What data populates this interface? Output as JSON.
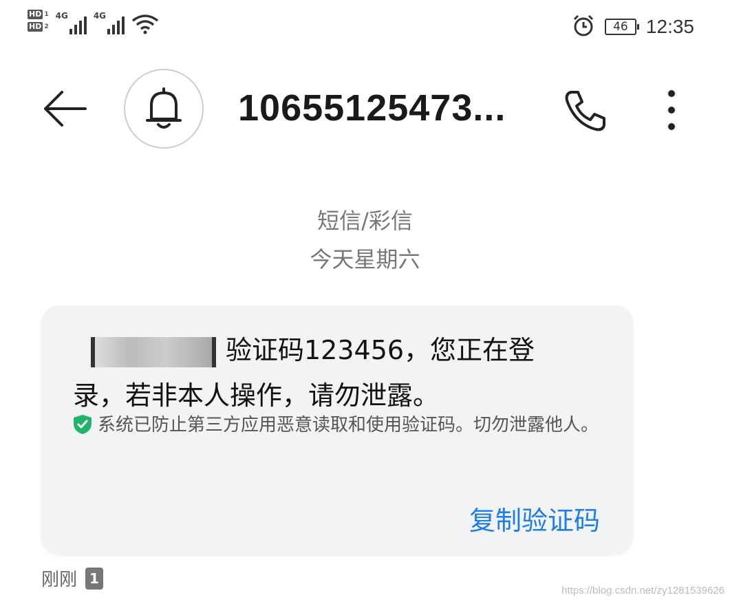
{
  "status_bar": {
    "sim1_label": "HD",
    "sim1_index": "1",
    "sim2_label": "HD",
    "sim2_index": "2",
    "network1": "4G",
    "network2": "4G",
    "battery": "46",
    "time": "12:35",
    "icons": [
      "hd-icon",
      "signal-icon",
      "wifi-icon",
      "alarm-icon",
      "battery-icon"
    ]
  },
  "header": {
    "sender": "10655125473...",
    "icons": [
      "back-arrow-icon",
      "bell-icon",
      "phone-icon",
      "more-vertical-icon"
    ]
  },
  "conversation": {
    "message_type": "短信/彩信",
    "date": "今天星期六"
  },
  "message": {
    "text": "验证码123456，您正在登录，若非本人操作，请勿泄露。",
    "notice": "系统已防止第三方应用恶意读取和使用验证码。切勿泄露他人。",
    "copy_label": "复制验证码",
    "time": "刚刚",
    "sim": "1"
  },
  "watermark": "https://blog.csdn.net/zy1281539626",
  "colors": {
    "accent": "#1f7de6",
    "shield": "#22b36b",
    "bubble": "#f2f3f5"
  }
}
